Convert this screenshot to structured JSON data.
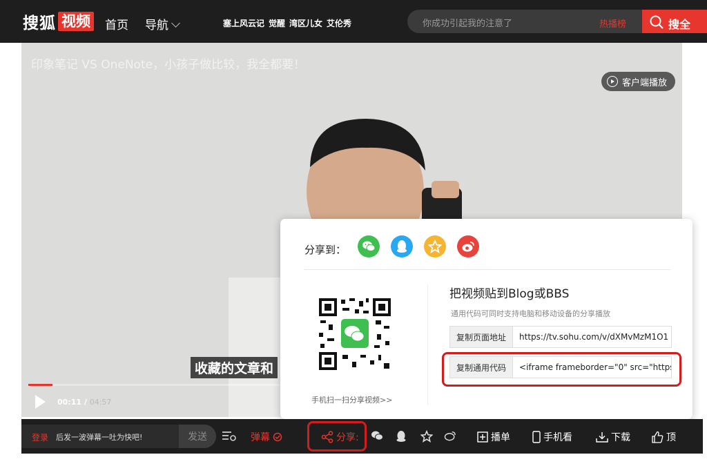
{
  "header": {
    "logo_text": "搜狐",
    "logo_badge": "视频",
    "nav": {
      "home": "首页",
      "guide": "导航"
    },
    "hot_tags": [
      "塞上风云记",
      "觉醒",
      "湾区儿女",
      "艾伦秀"
    ],
    "search_placeholder": "你成功引起我的注意了",
    "hot_rank": "热播榜",
    "search_button": "搜全"
  },
  "player": {
    "video_title": "印象笔记 VS OneNote，小孩子做比较，我全都要！",
    "client_play": "客户端播放",
    "subtitle": "收藏的文章和",
    "current_time": "00:11",
    "total_time": "04:57",
    "progress_fraction": 0.037
  },
  "share_popup": {
    "share_to_label": "分享到：",
    "share_targets": [
      "wechat-icon",
      "qq-icon",
      "qzone-icon",
      "weibo-icon"
    ],
    "qr_caption": "手机扫一扫分享视频>>",
    "embed_title": "把视频贴到Blog或BBS",
    "embed_desc": "通用代码可同时支持电脑和移动设备的分享播放",
    "copy_url_button": "复制页面地址",
    "page_url": "https://tv.sohu.com/v/dXMvMzM1O1",
    "copy_code_button": "复制通用代码",
    "embed_code": "<iframe frameborder=\"0\" src=\"https:"
  },
  "controls": {
    "login": "登录",
    "danmu_placeholder": "后发一波弹幕一吐为快吧!",
    "send": "发送",
    "danmu_label": "弹幕",
    "share_label": "分享:",
    "playlist": "播单",
    "mobile": "手机看",
    "download": "下载",
    "like": "顶"
  },
  "colors": {
    "brand_red": "#e6362d",
    "bar_bg": "#1e1e1e",
    "highlight_red": "#d11d1d"
  }
}
